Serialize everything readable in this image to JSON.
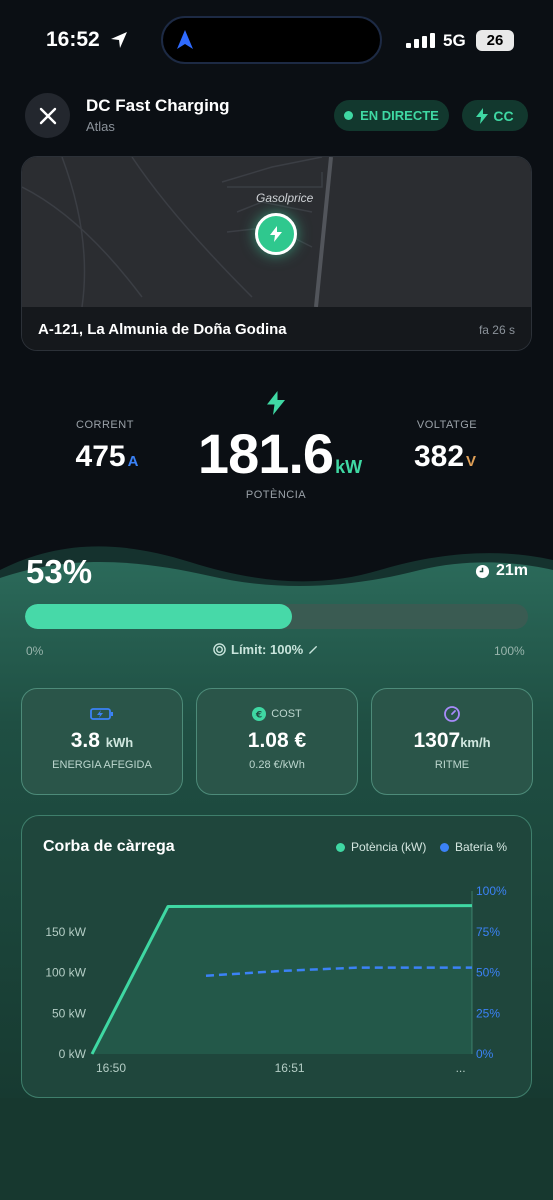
{
  "status_bar": {
    "time": "16:52",
    "network": "5G",
    "battery": "26"
  },
  "header": {
    "title": "DC Fast Charging",
    "subtitle": "Atlas",
    "live_label": "EN DIRECTE",
    "mode_label": "CC"
  },
  "map": {
    "poi_label": "Gasolprice",
    "address": "A-121, La Almunia de Doña Godina",
    "updated": "fa 26 s"
  },
  "metrics": {
    "current": {
      "label": "CORRENT",
      "value": "475",
      "unit": "A"
    },
    "power": {
      "label": "POTÈNCIA",
      "value": "181.6",
      "unit": "kW"
    },
    "voltage": {
      "label": "VOLTATGE",
      "value": "382",
      "unit": "V"
    }
  },
  "charge": {
    "percent_label": "53%",
    "percent": 0.53,
    "eta": "21m",
    "min_label": "0%",
    "max_label": "100%",
    "limit_label": "Límit: 100%"
  },
  "cards": [
    {
      "label": "ENERGIA AFEGIDA",
      "value": "3.8",
      "unit": "kWh",
      "icon": "battery-charging-icon",
      "color": "#3b82f6"
    },
    {
      "label": "COST",
      "value": "1.08 €",
      "sub": "0.28 €/kWh",
      "icon": "euro-icon",
      "color": "#3fd8a3"
    },
    {
      "label": "RITME",
      "value": "1307",
      "unit": "km/h",
      "icon": "gauge-icon",
      "color": "#a78bfa"
    }
  ],
  "chart_data": {
    "type": "line",
    "title": "Corba de càrrega",
    "x": [
      "16:50",
      "16:51",
      "..."
    ],
    "y_ticks_left": [
      "0 kW",
      "50 kW",
      "100 kW",
      "150 kW"
    ],
    "y_ticks_right": [
      "0%",
      "25%",
      "50%",
      "75%",
      "100%"
    ],
    "series": [
      {
        "name": "Potència (kW)",
        "color": "#3fd8a3",
        "axis": "left",
        "points": [
          [
            0,
            0
          ],
          [
            0.2,
            181
          ],
          [
            1,
            182
          ]
        ]
      },
      {
        "name": "Bateria %",
        "color": "#3b82f6",
        "axis": "right",
        "dashed": true,
        "points": [
          [
            0.3,
            48
          ],
          [
            0.5,
            51
          ],
          [
            0.7,
            53
          ],
          [
            1,
            53
          ]
        ]
      }
    ],
    "ylim_left": [
      0,
      200
    ],
    "ylim_right": [
      0,
      100
    ],
    "grid": false,
    "legend": "top-right"
  }
}
